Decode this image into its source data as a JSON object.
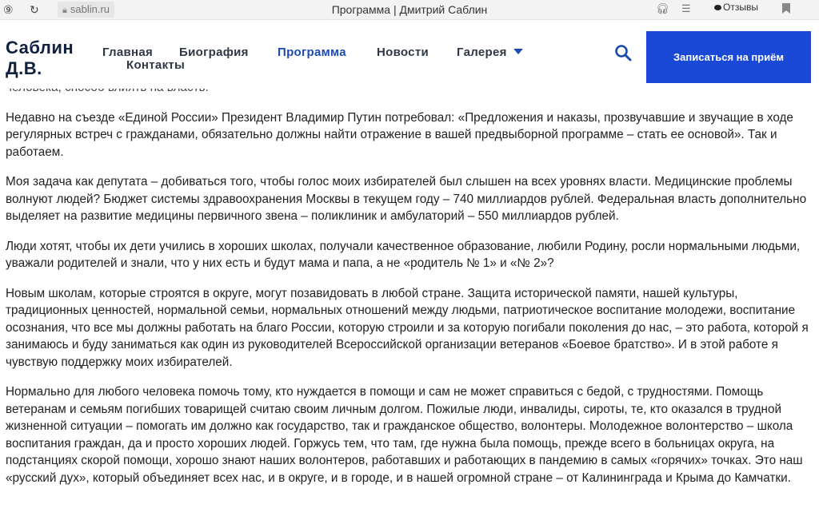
{
  "browser": {
    "url": "sablin.ru",
    "tab_title": "Программа | Дмитрий Саблин",
    "reviews_label": "Отзывы"
  },
  "header": {
    "logo_line1": "Саблин",
    "logo_line2": "Д.В.",
    "nav": {
      "home": "Главная",
      "bio": "Биография",
      "program": "Программа",
      "news": "Новости",
      "gallery": "Галерея",
      "contacts": "Контакты"
    },
    "cta_label": "Записаться на приём"
  },
  "content": {
    "cut_line": "человека, способ влиять на власть.",
    "paragraphs": [
      "Недавно на съезде «Единой России» Президент Владимир Путин потребовал: «Предложения и наказы, прозвучавшие и звучащие в ходе регулярных встреч с гражданами, обязательно должны найти отражение в вашей предвыборной программе – стать ее основой». Так и работаем.",
      "Моя задача как депутата – добиваться того, чтобы голос моих избирателей был слышен на всех уровнях власти. Медицинские проблемы волнуют людей? Бюджет системы здравоохранения Москвы в текущем году – 740 миллиардов рублей. Федеральная власть дополнительно выделяет на развитие медицины первичного звена – поликлиник и амбулаторий – 550 миллиардов рублей.",
      "Люди хотят, чтобы их дети учились в хороших школах, получали качественное образование, любили Родину, росли нормальными людьми, уважали родителей и знали, что у них есть и будут мама и папа, а не «родитель № 1» и «№ 2»?",
      "Новым школам, которые строятся в округе, могут позавидовать в любой стране. Защита исторической памяти, нашей культуры, традиционных ценностей, нормальной семьи, нормальных отношений между людьми, патриотическое воспитание молодежи, воспитание осознания, что все мы должны работать на благо России, которую строили и за которую погибали поколения до нас, – это работа, которой я занимаюсь и буду заниматься как один из руководителей Всероссийской организации ветеранов «Боевое братство». И в этой работе я чувствую поддержку моих избирателей.",
      "Нормально для любого человека помочь тому, кто нуждается в помощи и сам не может справиться с бедой, с трудностями. Помощь ветеранам и семьям погибших товарищей считаю своим личным долгом. Пожилые люди, инвалиды, сироты, те, кто оказался в трудной жизненной ситуации – помогать им должно как государство, так и гражданское общество, волонтеры. Молодежное волонтерство – школа воспитания граждан, да и просто хороших людей. Горжусь тем, что там, где нужна была помощь, прежде всего в больницах округа, на подстанциях скорой помощи, хорошо знают наших волонтеров, работавших и работающих в пандемию в самых «горячих» точках. Это наш «русский дух», который объединяет всех нас, и в округе, и в городе, и в нашей огромной стране – от Калининграда и Крыма до Камчатки."
    ]
  }
}
